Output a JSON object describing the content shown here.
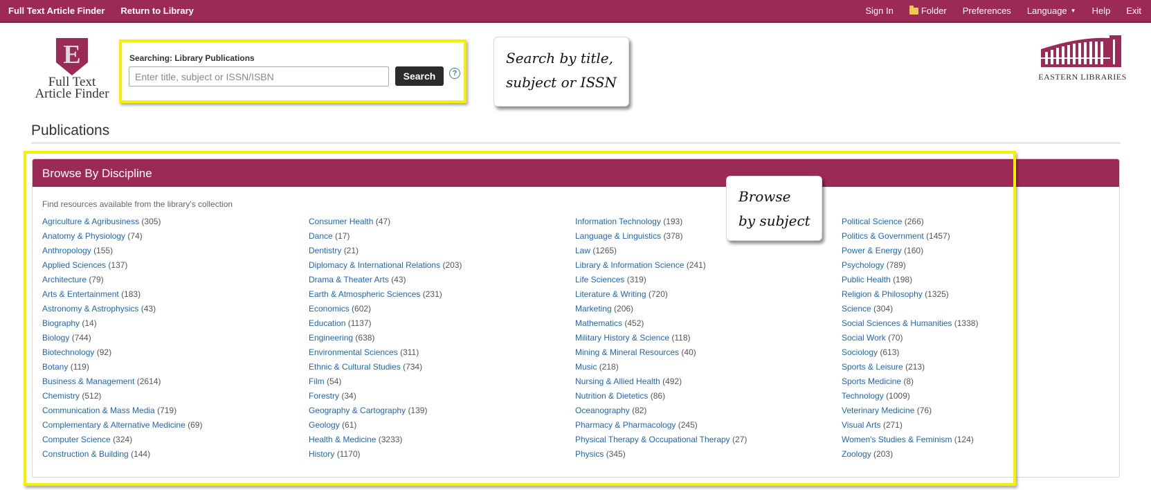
{
  "topbar": {
    "left": [
      "Full Text Article Finder",
      "Return to Library"
    ],
    "right": {
      "sign_in": "Sign In",
      "folder": "Folder",
      "preferences": "Preferences",
      "language": "Language",
      "help": "Help",
      "exit": "Exit"
    }
  },
  "logo": {
    "letter": "E",
    "line1": "Full Text",
    "line2": "Article Finder"
  },
  "search": {
    "label": "Searching: Library Publications",
    "placeholder": "Enter title, subject or ISSN/ISBN",
    "button": "Search",
    "help": "?"
  },
  "callouts": {
    "search_line1": "Search by title,",
    "search_line2": "subject or ISSN",
    "browse_line1": "Browse",
    "browse_line2": "by subject"
  },
  "eastern_logo": {
    "text": "EASTERN LIBRARIES"
  },
  "page": {
    "title": "Publications"
  },
  "panel": {
    "title": "Browse By Discipline",
    "subtitle": "Find resources available from the library's collection"
  },
  "disciplines": [
    [
      {
        "name": "Agriculture & Agribusiness",
        "count": "(305)"
      },
      {
        "name": "Anatomy & Physiology",
        "count": "(74)"
      },
      {
        "name": "Anthropology",
        "count": "(155)"
      },
      {
        "name": "Applied Sciences",
        "count": "(137)"
      },
      {
        "name": "Architecture",
        "count": "(79)"
      },
      {
        "name": "Arts & Entertainment",
        "count": "(183)"
      },
      {
        "name": "Astronomy & Astrophysics",
        "count": "(43)"
      },
      {
        "name": "Biography",
        "count": "(14)"
      },
      {
        "name": "Biology",
        "count": "(744)"
      },
      {
        "name": "Biotechnology",
        "count": "(92)"
      },
      {
        "name": "Botany",
        "count": "(119)"
      },
      {
        "name": "Business & Management",
        "count": "(2614)"
      },
      {
        "name": "Chemistry",
        "count": "(512)"
      },
      {
        "name": "Communication & Mass Media",
        "count": "(719)"
      },
      {
        "name": "Complementary & Alternative Medicine",
        "count": "(69)"
      },
      {
        "name": "Computer Science",
        "count": "(324)"
      },
      {
        "name": "Construction & Building",
        "count": "(144)"
      }
    ],
    [
      {
        "name": "Consumer Health",
        "count": "(47)"
      },
      {
        "name": "Dance",
        "count": "(17)"
      },
      {
        "name": "Dentistry",
        "count": "(21)"
      },
      {
        "name": "Diplomacy & International Relations",
        "count": "(203)"
      },
      {
        "name": "Drama & Theater Arts",
        "count": "(43)"
      },
      {
        "name": "Earth & Atmospheric Sciences",
        "count": "(231)"
      },
      {
        "name": "Economics",
        "count": "(602)"
      },
      {
        "name": "Education",
        "count": "(1137)"
      },
      {
        "name": "Engineering",
        "count": "(638)"
      },
      {
        "name": "Environmental Sciences",
        "count": "(311)"
      },
      {
        "name": "Ethnic & Cultural Studies",
        "count": "(734)"
      },
      {
        "name": "Film",
        "count": "(54)"
      },
      {
        "name": "Forestry",
        "count": "(34)"
      },
      {
        "name": "Geography & Cartography",
        "count": "(139)"
      },
      {
        "name": "Geology",
        "count": "(61)"
      },
      {
        "name": "Health & Medicine",
        "count": "(3233)"
      },
      {
        "name": "History",
        "count": "(1170)"
      }
    ],
    [
      {
        "name": "Information Technology",
        "count": "(193)"
      },
      {
        "name": "Language & Linguistics",
        "count": "(378)"
      },
      {
        "name": "Law",
        "count": "(1265)"
      },
      {
        "name": "Library & Information Science",
        "count": "(241)"
      },
      {
        "name": "Life Sciences",
        "count": "(319)"
      },
      {
        "name": "Literature & Writing",
        "count": "(720)"
      },
      {
        "name": "Marketing",
        "count": "(206)"
      },
      {
        "name": "Mathematics",
        "count": "(452)"
      },
      {
        "name": "Military History & Science",
        "count": "(118)"
      },
      {
        "name": "Mining & Mineral Resources",
        "count": "(40)"
      },
      {
        "name": "Music",
        "count": "(218)"
      },
      {
        "name": "Nursing & Allied Health",
        "count": "(492)"
      },
      {
        "name": "Nutrition & Dietetics",
        "count": "(86)"
      },
      {
        "name": "Oceanography",
        "count": "(82)"
      },
      {
        "name": "Pharmacy & Pharmacology",
        "count": "(245)"
      },
      {
        "name": "Physical Therapy & Occupational Therapy",
        "count": "(27)"
      },
      {
        "name": "Physics",
        "count": "(345)"
      }
    ],
    [
      {
        "name": "Political Science",
        "count": "(266)"
      },
      {
        "name": "Politics & Government",
        "count": "(1457)"
      },
      {
        "name": "Power & Energy",
        "count": "(160)"
      },
      {
        "name": "Psychology",
        "count": "(789)"
      },
      {
        "name": "Public Health",
        "count": "(198)"
      },
      {
        "name": "Religion & Philosophy",
        "count": "(1325)"
      },
      {
        "name": "Science",
        "count": "(304)"
      },
      {
        "name": "Social Sciences & Humanities",
        "count": "(1338)"
      },
      {
        "name": "Social Work",
        "count": "(70)"
      },
      {
        "name": "Sociology",
        "count": "(613)"
      },
      {
        "name": "Sports & Leisure",
        "count": "(213)"
      },
      {
        "name": "Sports Medicine",
        "count": "(8)"
      },
      {
        "name": "Technology",
        "count": "(1009)"
      },
      {
        "name": "Veterinary Medicine",
        "count": "(76)"
      },
      {
        "name": "Visual Arts",
        "count": "(271)"
      },
      {
        "name": "Women's Studies & Feminism",
        "count": "(124)"
      },
      {
        "name": "Zoology",
        "count": "(203)"
      }
    ]
  ],
  "colors": {
    "brand": "#9c2a57",
    "link": "#1f66b3",
    "highlight": "#f5f000"
  }
}
